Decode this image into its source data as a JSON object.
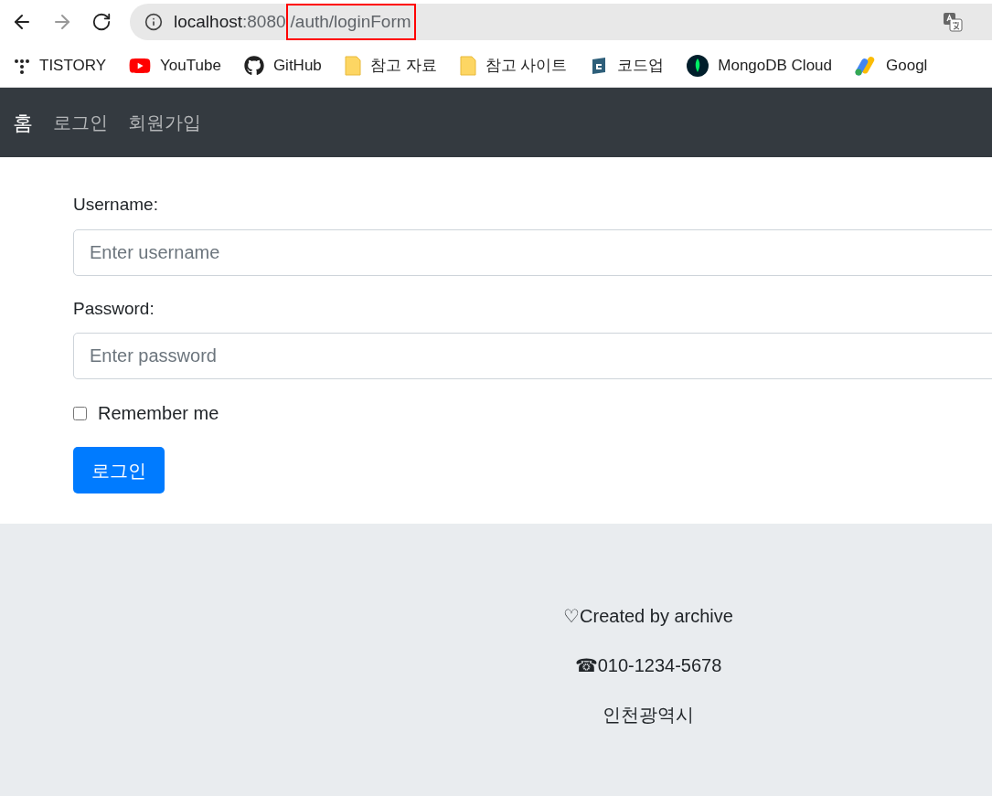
{
  "browser": {
    "url_host": "localhost",
    "url_rest": ":8080",
    "url_path": "/auth/loginForm",
    "bookmarks": [
      {
        "label": "TISTORY",
        "kind": "dots"
      },
      {
        "label": "YouTube",
        "kind": "youtube"
      },
      {
        "label": "GitHub",
        "kind": "github"
      },
      {
        "label": "참고 자료",
        "kind": "folder"
      },
      {
        "label": "참고 사이트",
        "kind": "folder"
      },
      {
        "label": "코드업",
        "kind": "cube"
      },
      {
        "label": "MongoDB Cloud",
        "kind": "leaf"
      },
      {
        "label": "Googl",
        "kind": "ads"
      }
    ]
  },
  "navbar": {
    "brand": "홈",
    "links": [
      "로그인",
      "회원가입"
    ]
  },
  "form": {
    "fields": [
      {
        "label": "Username:",
        "placeholder": "Enter username"
      },
      {
        "label": "Password:",
        "placeholder": "Enter password"
      }
    ],
    "remember": {
      "label": "Remember me",
      "checked": false
    },
    "submit": "로그인"
  },
  "footer": {
    "lines": [
      "♡Created by archive",
      "☎010-1234-5678",
      "인천광역시"
    ]
  }
}
